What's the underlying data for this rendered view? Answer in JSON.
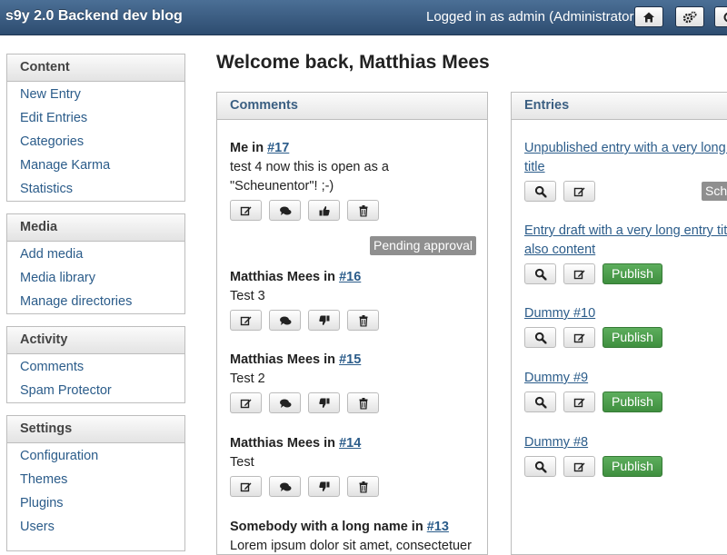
{
  "app": {
    "title": "s9y 2.0 Backend dev blog",
    "login_text": "Logged in as admin (Administrator)"
  },
  "topbar_buttons": [
    {
      "icon": "home-icon"
    },
    {
      "icon": "gears-icon"
    },
    {
      "icon": "user-icon"
    }
  ],
  "sidebar": {
    "sections": [
      {
        "title": "Content",
        "items": [
          "New Entry",
          "Edit Entries",
          "Categories",
          "Manage Karma",
          "Statistics"
        ]
      },
      {
        "title": "Media",
        "items": [
          "Add media",
          "Media library",
          "Manage directories"
        ]
      },
      {
        "title": "Activity",
        "items": [
          "Comments",
          "Spam Protector"
        ]
      },
      {
        "title": "Settings",
        "items": [
          "Configuration",
          "Themes",
          "Plugins",
          "Users"
        ]
      }
    ]
  },
  "main": {
    "welcome": "Welcome back, Matthias Mees",
    "comments": {
      "title": "Comments",
      "items": [
        {
          "author": "Me",
          "in": " in ",
          "ref": "#17",
          "text": "test 4 now this is open as a \"Scheunentor\"! ;-)",
          "vote_icon": "thumbs-up-icon",
          "badge": "Pending approval"
        },
        {
          "author": "Matthias Mees",
          "in": " in ",
          "ref": "#16",
          "text": "Test 3",
          "vote_icon": "thumbs-down-icon"
        },
        {
          "author": "Matthias Mees",
          "in": " in ",
          "ref": "#15",
          "text": "Test 2",
          "vote_icon": "thumbs-down-icon"
        },
        {
          "author": "Matthias Mees",
          "in": " in ",
          "ref": "#14",
          "text": "Test",
          "vote_icon": "thumbs-down-icon"
        },
        {
          "author": "Somebody with a long name",
          "in": " in ",
          "ref": "#13",
          "text": "Lorem ipsum dolor sit amet, consectetuer"
        }
      ]
    },
    "entries": {
      "title": "Entries",
      "items": [
        {
          "title": "Unpublished entry with a very long e title",
          "badge": "Sch"
        },
        {
          "title": "Entry draft with a very long entry title also content",
          "publish": "Publish"
        },
        {
          "title": "Dummy #10",
          "publish": "Publish"
        },
        {
          "title": "Dummy #9",
          "publish": "Publish"
        },
        {
          "title": "Dummy #8",
          "publish": "Publish"
        }
      ]
    }
  },
  "colors": {
    "topbar": "#3a5c82",
    "link": "#2b5c8a",
    "publish": "#4a9a4a",
    "badge": "#8f8f8f"
  }
}
